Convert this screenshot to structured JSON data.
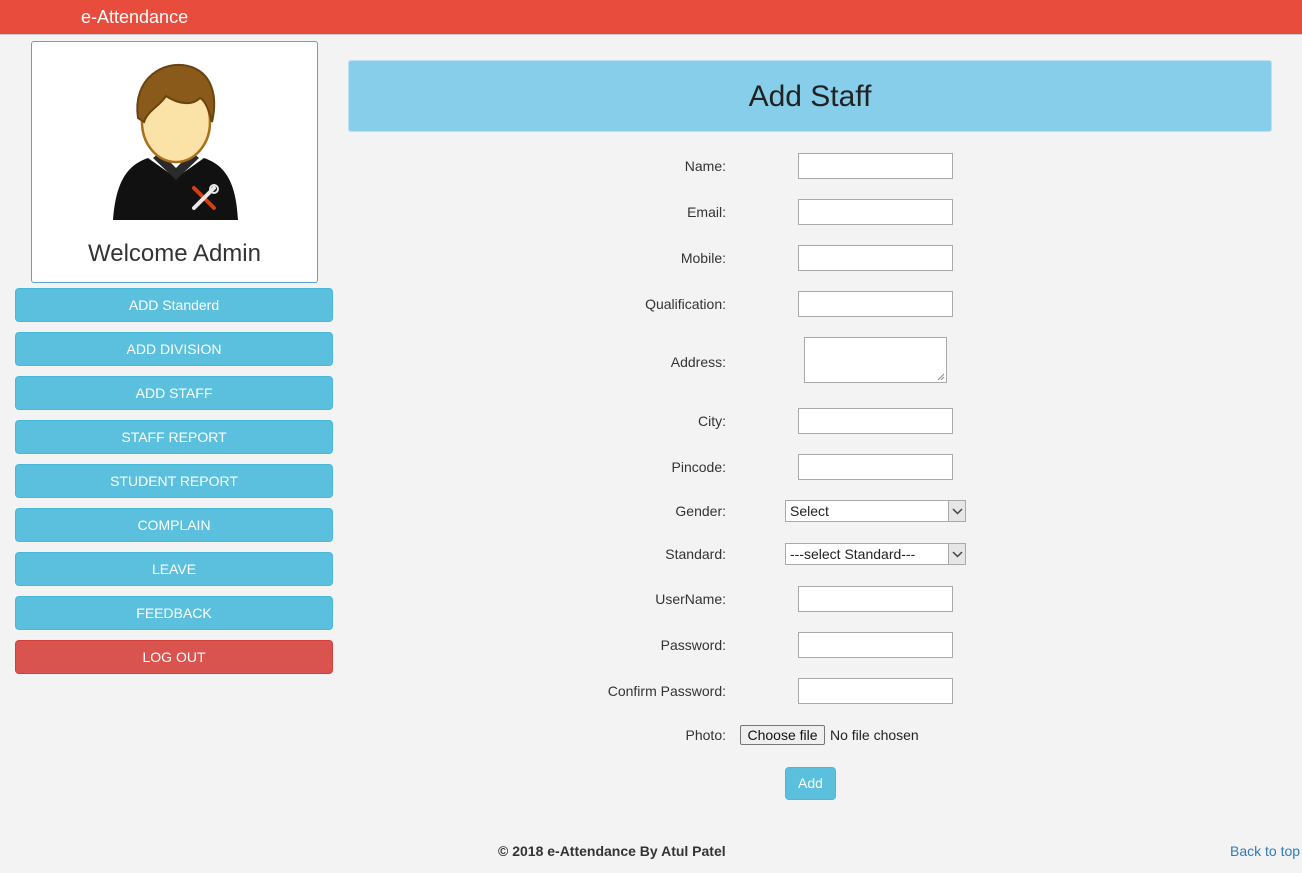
{
  "app": {
    "title": "e-Attendance"
  },
  "colors": {
    "topbar": "#e84c3d",
    "info": "#5bc0de",
    "danger": "#d9534f",
    "header_panel": "#87ceeb",
    "link": "#337ab7"
  },
  "profile": {
    "welcome": "Welcome Admin",
    "avatar_icon": "admin-avatar-icon"
  },
  "sidebar": {
    "items": [
      {
        "label": "ADD Standerd"
      },
      {
        "label": "ADD DIVISION"
      },
      {
        "label": "ADD STAFF"
      },
      {
        "label": "STAFF REPORT"
      },
      {
        "label": "STUDENT REPORT"
      },
      {
        "label": "COMPLAIN"
      },
      {
        "label": "LEAVE"
      },
      {
        "label": "FEEDBACK"
      }
    ],
    "logout": "LOG OUT"
  },
  "page": {
    "heading": "Add Staff"
  },
  "form": {
    "name_label": "Name:",
    "name_value": "",
    "email_label": "Email:",
    "email_value": "",
    "mobile_label": "Mobile:",
    "mobile_value": "",
    "qualification_label": "Qualification:",
    "qualification_value": "",
    "address_label": "Address:",
    "address_value": "",
    "city_label": "City:",
    "city_value": "",
    "pincode_label": "Pincode:",
    "pincode_value": "",
    "gender_label": "Gender:",
    "gender_selected": "Select",
    "standard_label": "Standard:",
    "standard_selected": "---select Standard---",
    "username_label": "UserName:",
    "username_value": "",
    "password_label": "Password:",
    "password_value": "",
    "confirm_label": "Confirm Password:",
    "confirm_value": "",
    "photo_label": "Photo:",
    "file_button": "Choose file",
    "file_status": "No file chosen",
    "submit": "Add"
  },
  "footer": {
    "copyright": "© 2018 e-Attendance By Atul Patel",
    "back_to_top": "Back to top"
  }
}
